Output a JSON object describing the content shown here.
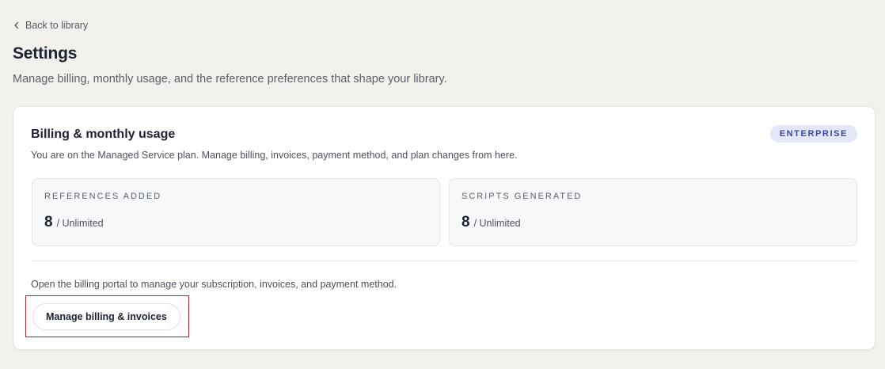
{
  "nav": {
    "back_label": "Back to library",
    "back_icon": "chevron-left-icon"
  },
  "header": {
    "title": "Settings",
    "subtitle": "Manage billing, monthly usage, and the reference preferences that shape your library."
  },
  "billing": {
    "title": "Billing & monthly usage",
    "plan_badge": "ENTERPRISE",
    "description": "You are on the Managed Service plan. Manage billing, invoices, payment method, and plan changes from here.",
    "stats": {
      "references": {
        "label": "REFERENCES ADDED",
        "value": "8",
        "limit": "/ Unlimited"
      },
      "scripts": {
        "label": "SCRIPTS GENERATED",
        "value": "8",
        "limit": "/ Unlimited"
      }
    },
    "portal_text": "Open the billing portal to manage your subscription, invoices, and payment method.",
    "manage_button_label": "Manage billing & invoices"
  },
  "colors": {
    "page_background": "#f2f1ee",
    "badge_background": "#e4e7f7",
    "badge_text": "#3a46a8",
    "highlight_border": "#a3282b"
  }
}
